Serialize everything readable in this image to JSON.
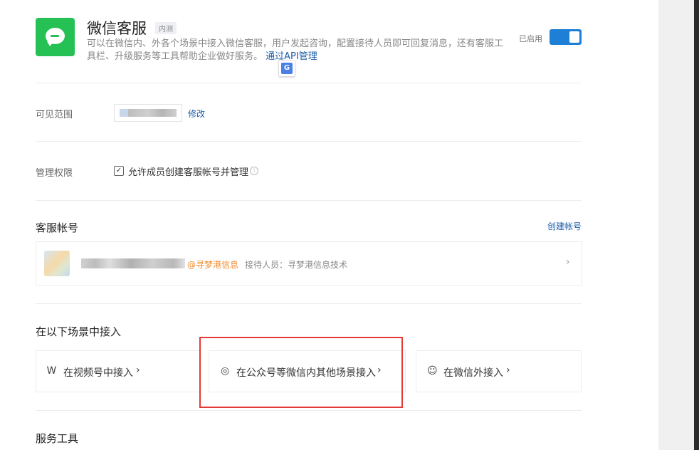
{
  "app": {
    "title": "微信客服",
    "badge": "内测",
    "description": "可以在微信内、外各个场景中接入微信客服，用户发起咨询，配置接待人员即可回复消息，还有客服工具栏、升级服务等工具帮助企业做好服务。",
    "api_link": "通过API管理",
    "status_label": "已启用",
    "toggle_on": true,
    "icon": "wechat-service-bubble-icon",
    "icon_color": "#25c155",
    "accent_color": "#1e7fd6"
  },
  "visible_scope": {
    "label": "可见范围",
    "edit_link": "修改"
  },
  "permissions": {
    "label": "管理权限",
    "checkbox_label": "允许成员创建客服帐号并管理",
    "checked": true
  },
  "accounts": {
    "title": "客服帐号",
    "create_link": "创建帐号",
    "items": [
      {
        "tag": "@寻梦港信息",
        "staff": "接待人员：寻梦港信息技术"
      }
    ]
  },
  "scenes": {
    "title": "在以下场景中接入",
    "items": [
      {
        "label": "在视频号中接入",
        "icon": "channels-icon",
        "glyph": "Ꮃ"
      },
      {
        "label": "在公众号等微信内其他场景接入",
        "icon": "wechat-icon",
        "glyph": "◎"
      },
      {
        "label": "在微信外接入",
        "icon": "chat-bubble-icon",
        "glyph": "☺"
      }
    ],
    "arrow": "›"
  },
  "tools": {
    "title": "服务工具"
  }
}
